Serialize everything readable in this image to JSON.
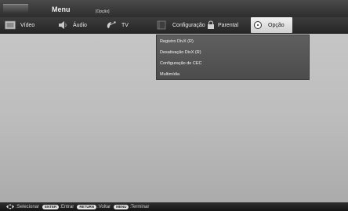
{
  "header": {
    "title": "Menu",
    "breadcrumb": "[Opção]"
  },
  "tabs": [
    {
      "label": "Vídeo",
      "icon": "film-icon"
    },
    {
      "label": "Áudio",
      "icon": "speaker-icon"
    },
    {
      "label": "TV",
      "icon": "satellite-dish-icon"
    },
    {
      "label": "Configuração",
      "icon": "settings-film-icon"
    },
    {
      "label": "Parental",
      "icon": "lock-icon"
    },
    {
      "label": "Opção",
      "icon": "option-disc-icon",
      "active": true
    }
  ],
  "dropdown": {
    "items": [
      "Registro DivX (R)",
      "Desativação DivX (R)",
      "Configuração de CEC",
      "Multimídia"
    ]
  },
  "footer": {
    "nav_label": ":Selecionar",
    "enter_key": "ENTER",
    "enter_label": ":Entrar",
    "return_key": "RETURN",
    "return_label": ":Voltar",
    "menu_key": "MENU",
    "menu_label": ":Terminar"
  },
  "colors": {
    "background": "#c0c0c0",
    "bar": "#2e2e2e",
    "active_tab": "#e6e6e6",
    "dropdown": "#575757"
  }
}
